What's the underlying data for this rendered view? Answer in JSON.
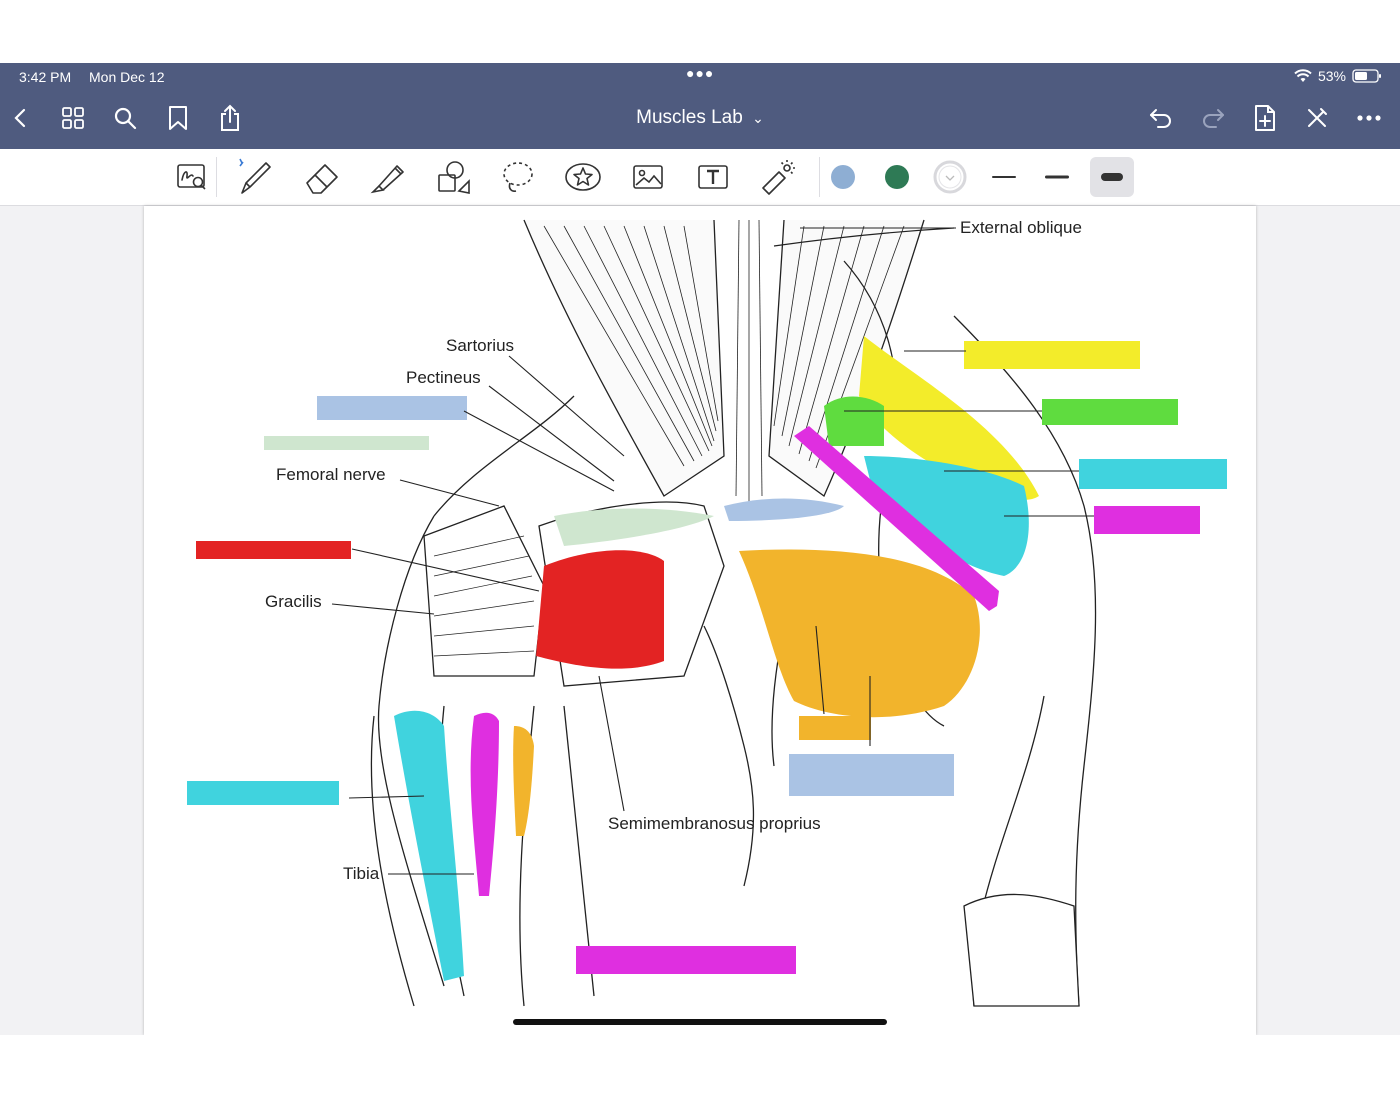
{
  "status": {
    "time": "3:42 PM",
    "date": "Mon Dec 12",
    "battery": "53%"
  },
  "document": {
    "title": "Muscles Lab",
    "title_chevron": "⌄"
  },
  "nav_icons_left": [
    "back-icon",
    "grid-icon",
    "search-icon",
    "bookmark-icon",
    "share-icon"
  ],
  "nav_icons_right": [
    "undo-icon",
    "redo-icon",
    "add-page-icon",
    "pen-off-icon",
    "more-icon"
  ],
  "toolbar": {
    "tools": [
      "zoom-handwriting-icon",
      "pen-icon",
      "eraser-icon",
      "highlighter-icon",
      "shapes-icon",
      "lasso-icon",
      "sticker-icon",
      "image-icon",
      "text-icon",
      "laser-pointer-icon"
    ],
    "colors": [
      "#8eaed3",
      "#2e7a55",
      "#ffffff"
    ],
    "selected_stroke": "thick"
  },
  "labels": {
    "external_oblique": "External oblique",
    "sartorius": "Sartorius",
    "pectineus": "Pectineus",
    "femoral_nerve": "Femoral nerve",
    "gracilis": "Gracilis",
    "semimembranosus": "Semimembranosus proprius",
    "tibia": "Tibia"
  },
  "highlight_colors": {
    "yellow": "#f3ec2a",
    "green": "#5fdc3f",
    "cyan": "#40d3de",
    "magenta": "#df2fe0",
    "orange": "#f2b42c",
    "red": "#e32323",
    "lightblue": "#aac3e4",
    "mint": "#cfe6cf"
  }
}
